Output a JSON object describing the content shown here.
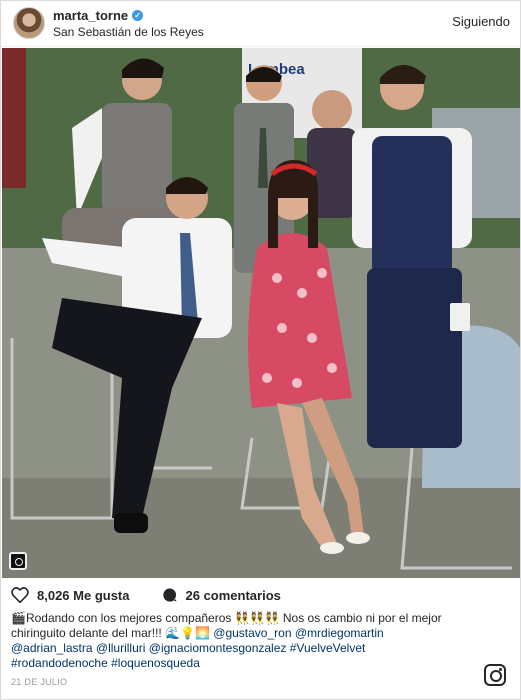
{
  "header": {
    "username": "marta_torne",
    "verified_icon": "verified-badge-icon",
    "location": "San Sebastián de los Reyes",
    "follow_label": "Siguiendo"
  },
  "photo": {
    "sign_text": "Lambea"
  },
  "actions": {
    "likes": "8,026 Me gusta",
    "comments": "26 comentarios"
  },
  "caption": {
    "line1": "🎬Rodando con los mejores compañeros 👯👯👯 Nos os cambio ni por el mejor",
    "line2": "chiringuito delante del mar!!! 🌊💡🌅",
    "mention1": "@gustavo_ron",
    "mention2": "@mrdiegomartin",
    "mention3": "@adrian_lastra",
    "mention4": "@llurilluri",
    "mention5": "@ignaciomontesgonzalez",
    "tag1": "#VuelveVelvet",
    "tag2": "#rodandodenoche",
    "tag3": "#loquenosqueda"
  },
  "date": "21 DE JULIO",
  "colors": {
    "verified": "#3897f0",
    "text": "#262626",
    "muted": "#999999",
    "link": "#003569"
  }
}
